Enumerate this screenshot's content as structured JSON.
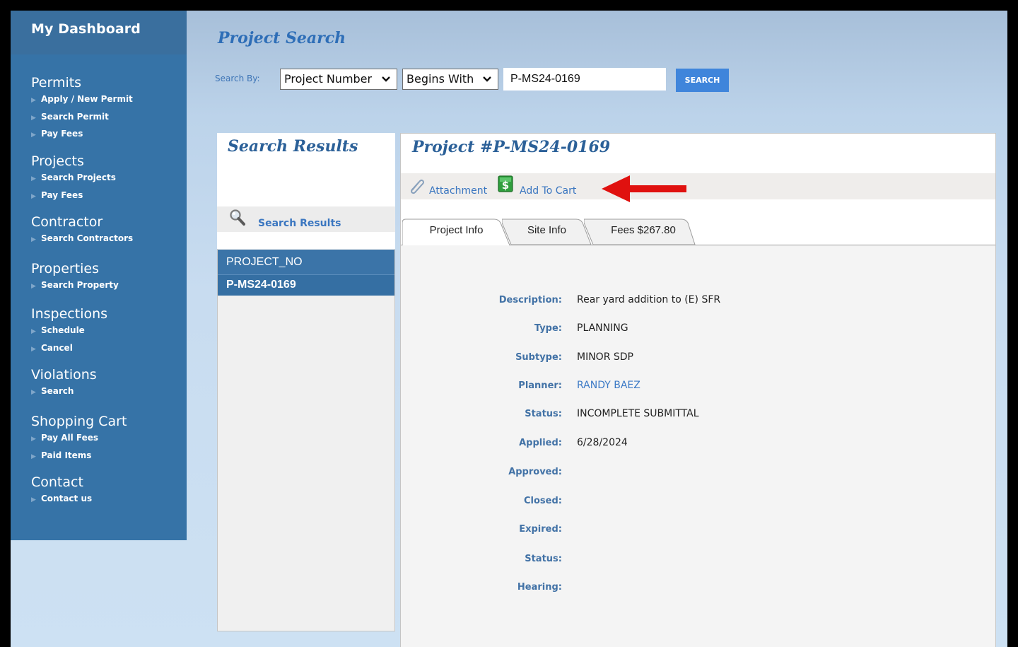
{
  "sidebar": {
    "dashboard": "My Dashboard",
    "sections": [
      {
        "title": "Permits",
        "items": [
          "Apply / New Permit",
          "Search Permit",
          "Pay Fees"
        ]
      },
      {
        "title": "Projects",
        "items": [
          "Search Projects",
          "Pay Fees"
        ]
      },
      {
        "title": "Contractor",
        "items": [
          "Search Contractors"
        ]
      },
      {
        "title": "Properties",
        "items": [
          "Search Property"
        ]
      },
      {
        "title": "Inspections",
        "items": [
          "Schedule",
          "Cancel"
        ]
      },
      {
        "title": "Violations",
        "items": [
          "Search"
        ]
      },
      {
        "title": "Shopping Cart",
        "items": [
          "Pay All Fees",
          "Paid Items"
        ]
      },
      {
        "title": "Contact",
        "items": [
          "Contact us"
        ]
      }
    ]
  },
  "header": {
    "title": "Project Search",
    "search_by_label": "Search By:",
    "field_select": "Project Number",
    "match_select": "Begins With",
    "search_value": "P-MS24-0169",
    "search_button": "SEARCH"
  },
  "results": {
    "title": "Search Results",
    "link": "Search Results",
    "column_header": "PROJECT_NO",
    "rows": [
      "P-MS24-0169"
    ]
  },
  "project": {
    "title": "Project #P-MS24-0169",
    "attachment": "Attachment",
    "add_to_cart": "Add To Cart",
    "tabs": [
      "Project Info",
      "Site Info",
      "Fees $267.80"
    ],
    "fields": [
      {
        "label": "Description:",
        "value": "Rear yard addition to (E) SFR"
      },
      {
        "label": "Type:",
        "value": "PLANNING"
      },
      {
        "label": "Subtype:",
        "value": "MINOR SDP"
      },
      {
        "label": "Planner:",
        "value": "RANDY BAEZ"
      },
      {
        "label": "Status:",
        "value": "INCOMPLETE SUBMITTAL"
      },
      {
        "label": "Applied:",
        "value": "6/28/2024"
      },
      {
        "label": "Approved:",
        "value": ""
      },
      {
        "label": "Closed:",
        "value": ""
      },
      {
        "label": "Expired:",
        "value": ""
      },
      {
        "label": "Status:",
        "value": ""
      },
      {
        "label": "Hearing:",
        "value": ""
      }
    ]
  },
  "colors": {
    "sidebar": "#3673a7",
    "accent": "#3f85db",
    "link": "#3a76c0",
    "arrow": "#e0110f"
  }
}
